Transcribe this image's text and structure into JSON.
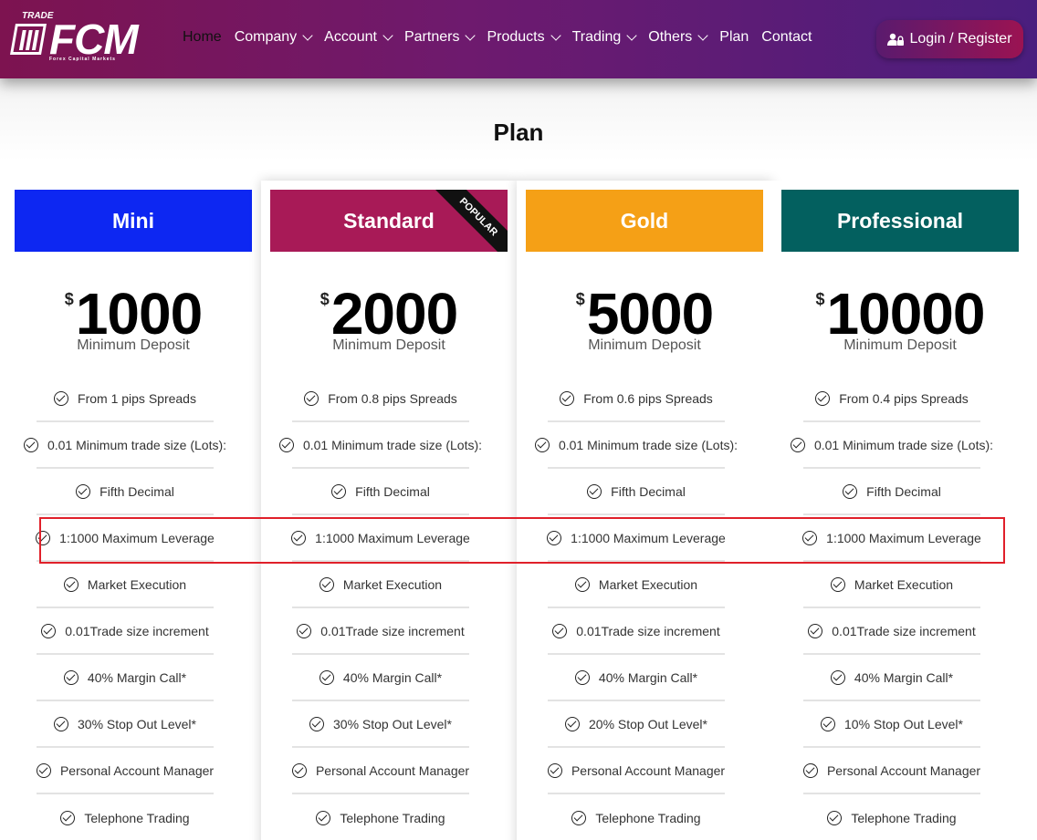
{
  "header": {
    "logo": {
      "top": "TRADE",
      "brand": "FCM",
      "subtitle": "Forex Capital Markets"
    },
    "nav": [
      {
        "label": "Home",
        "dropdown": false
      },
      {
        "label": "Company",
        "dropdown": true
      },
      {
        "label": "Account",
        "dropdown": true
      },
      {
        "label": "Partners",
        "dropdown": true
      },
      {
        "label": "Products",
        "dropdown": true
      },
      {
        "label": "Trading",
        "dropdown": true
      },
      {
        "label": "Others",
        "dropdown": true
      },
      {
        "label": "Plan",
        "dropdown": false
      },
      {
        "label": "Contact",
        "dropdown": false
      }
    ],
    "login_label": "Login / Register"
  },
  "page": {
    "title": "Plan"
  },
  "currency_symbol": "$",
  "min_deposit_label": "Minimum Deposit",
  "plans": [
    {
      "name": "Mini",
      "color": "#0d27f2",
      "amount": "1000",
      "ribbon": "",
      "features": [
        "From 1 pips Spreads",
        "0.01 Minimum trade size (Lots):",
        "Fifth Decimal",
        "1:1000 Maximum Leverage",
        "Market Execution",
        "0.01Trade size increment",
        "40% Margin Call*",
        "30% Stop Out Level*",
        "Personal Account Manager",
        "Telephone Trading"
      ]
    },
    {
      "name": "Standard",
      "color": "#a81a57",
      "amount": "2000",
      "ribbon": "POPULAR",
      "features": [
        "From 0.8 pips Spreads",
        "0.01 Minimum trade size (Lots):",
        "Fifth Decimal",
        "1:1000 Maximum Leverage",
        "Market Execution",
        "0.01Trade size increment",
        "40% Margin Call*",
        "30% Stop Out Level*",
        "Personal Account Manager",
        "Telephone Trading"
      ]
    },
    {
      "name": "Gold",
      "color": "#f5a016",
      "amount": "5000",
      "ribbon": "",
      "features": [
        "From 0.6 pips Spreads",
        "0.01 Minimum trade size (Lots):",
        "Fifth Decimal",
        "1:1000 Maximum Leverage",
        "Market Execution",
        "0.01Trade size increment",
        "40% Margin Call*",
        "20% Stop Out Level*",
        "Personal Account Manager",
        "Telephone Trading"
      ]
    },
    {
      "name": "Professional",
      "color": "#03605f",
      "amount": "10000",
      "ribbon": "",
      "features": [
        "From 0.4 pips Spreads",
        "0.01 Minimum trade size (Lots):",
        "Fifth Decimal",
        "1:1000 Maximum Leverage",
        "Market Execution",
        "0.01Trade size increment",
        "40% Margin Call*",
        "10% Stop Out Level*",
        "Personal Account Manager",
        "Telephone Trading"
      ]
    }
  ],
  "highlight_color": "#e0202a"
}
